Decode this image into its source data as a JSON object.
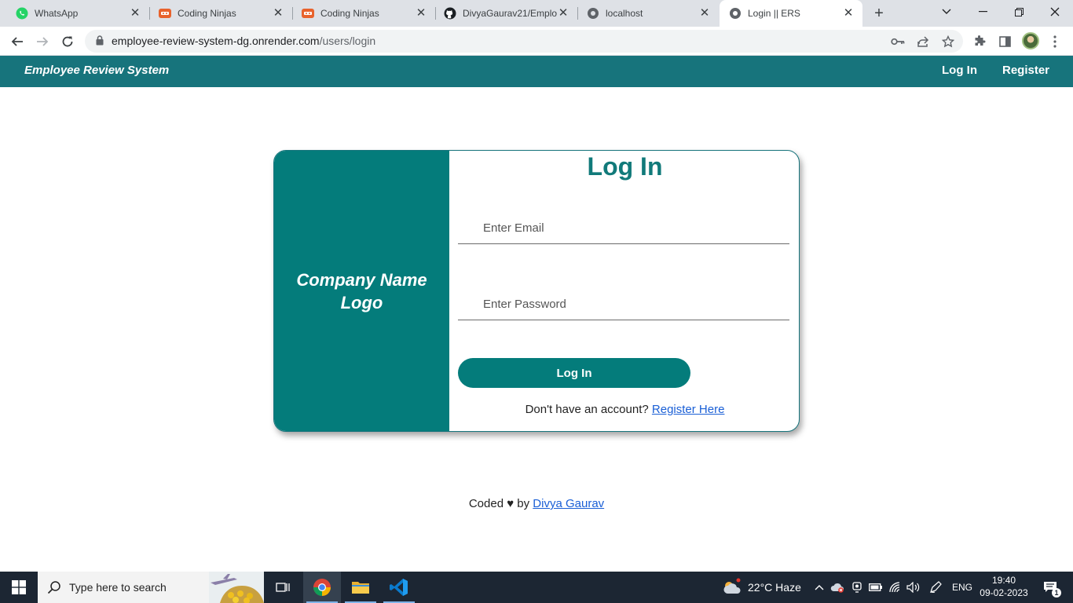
{
  "browser": {
    "tabs": [
      {
        "title": "WhatsApp",
        "icon": "whatsapp-icon",
        "active": false
      },
      {
        "title": "Coding Ninjas",
        "icon": "coding-ninjas-icon",
        "active": false
      },
      {
        "title": "Coding Ninjas",
        "icon": "coding-ninjas-icon",
        "active": false
      },
      {
        "title": "DivyaGaurav21/Emplo",
        "icon": "github-icon",
        "active": false
      },
      {
        "title": "localhost",
        "icon": "globe-icon",
        "active": false
      },
      {
        "title": "Login || ERS",
        "icon": "globe-icon",
        "active": true
      }
    ],
    "url_host": "employee-review-system-dg.onrender.com",
    "url_path": "/users/login"
  },
  "site": {
    "brand": "Employee Review System",
    "nav": {
      "login": "Log In",
      "register": "Register"
    },
    "accent_color": "#047c7b"
  },
  "login": {
    "logo_text": "Company Name Logo",
    "title": "Log In",
    "email_placeholder": "Enter Email",
    "password_placeholder": "Enter Password",
    "submit_label": "Log In",
    "register_prompt": "Don't have an account?",
    "register_link": "Register Here"
  },
  "footer": {
    "prefix": "Coded",
    "heart": "♥",
    "by": "by",
    "author": "Divya Gaurav"
  },
  "taskbar": {
    "search_placeholder": "Type here to search",
    "weather": "22°C  Haze",
    "language": "ENG",
    "time": "19:40",
    "date": "09-02-2023",
    "notification_count": "1"
  }
}
